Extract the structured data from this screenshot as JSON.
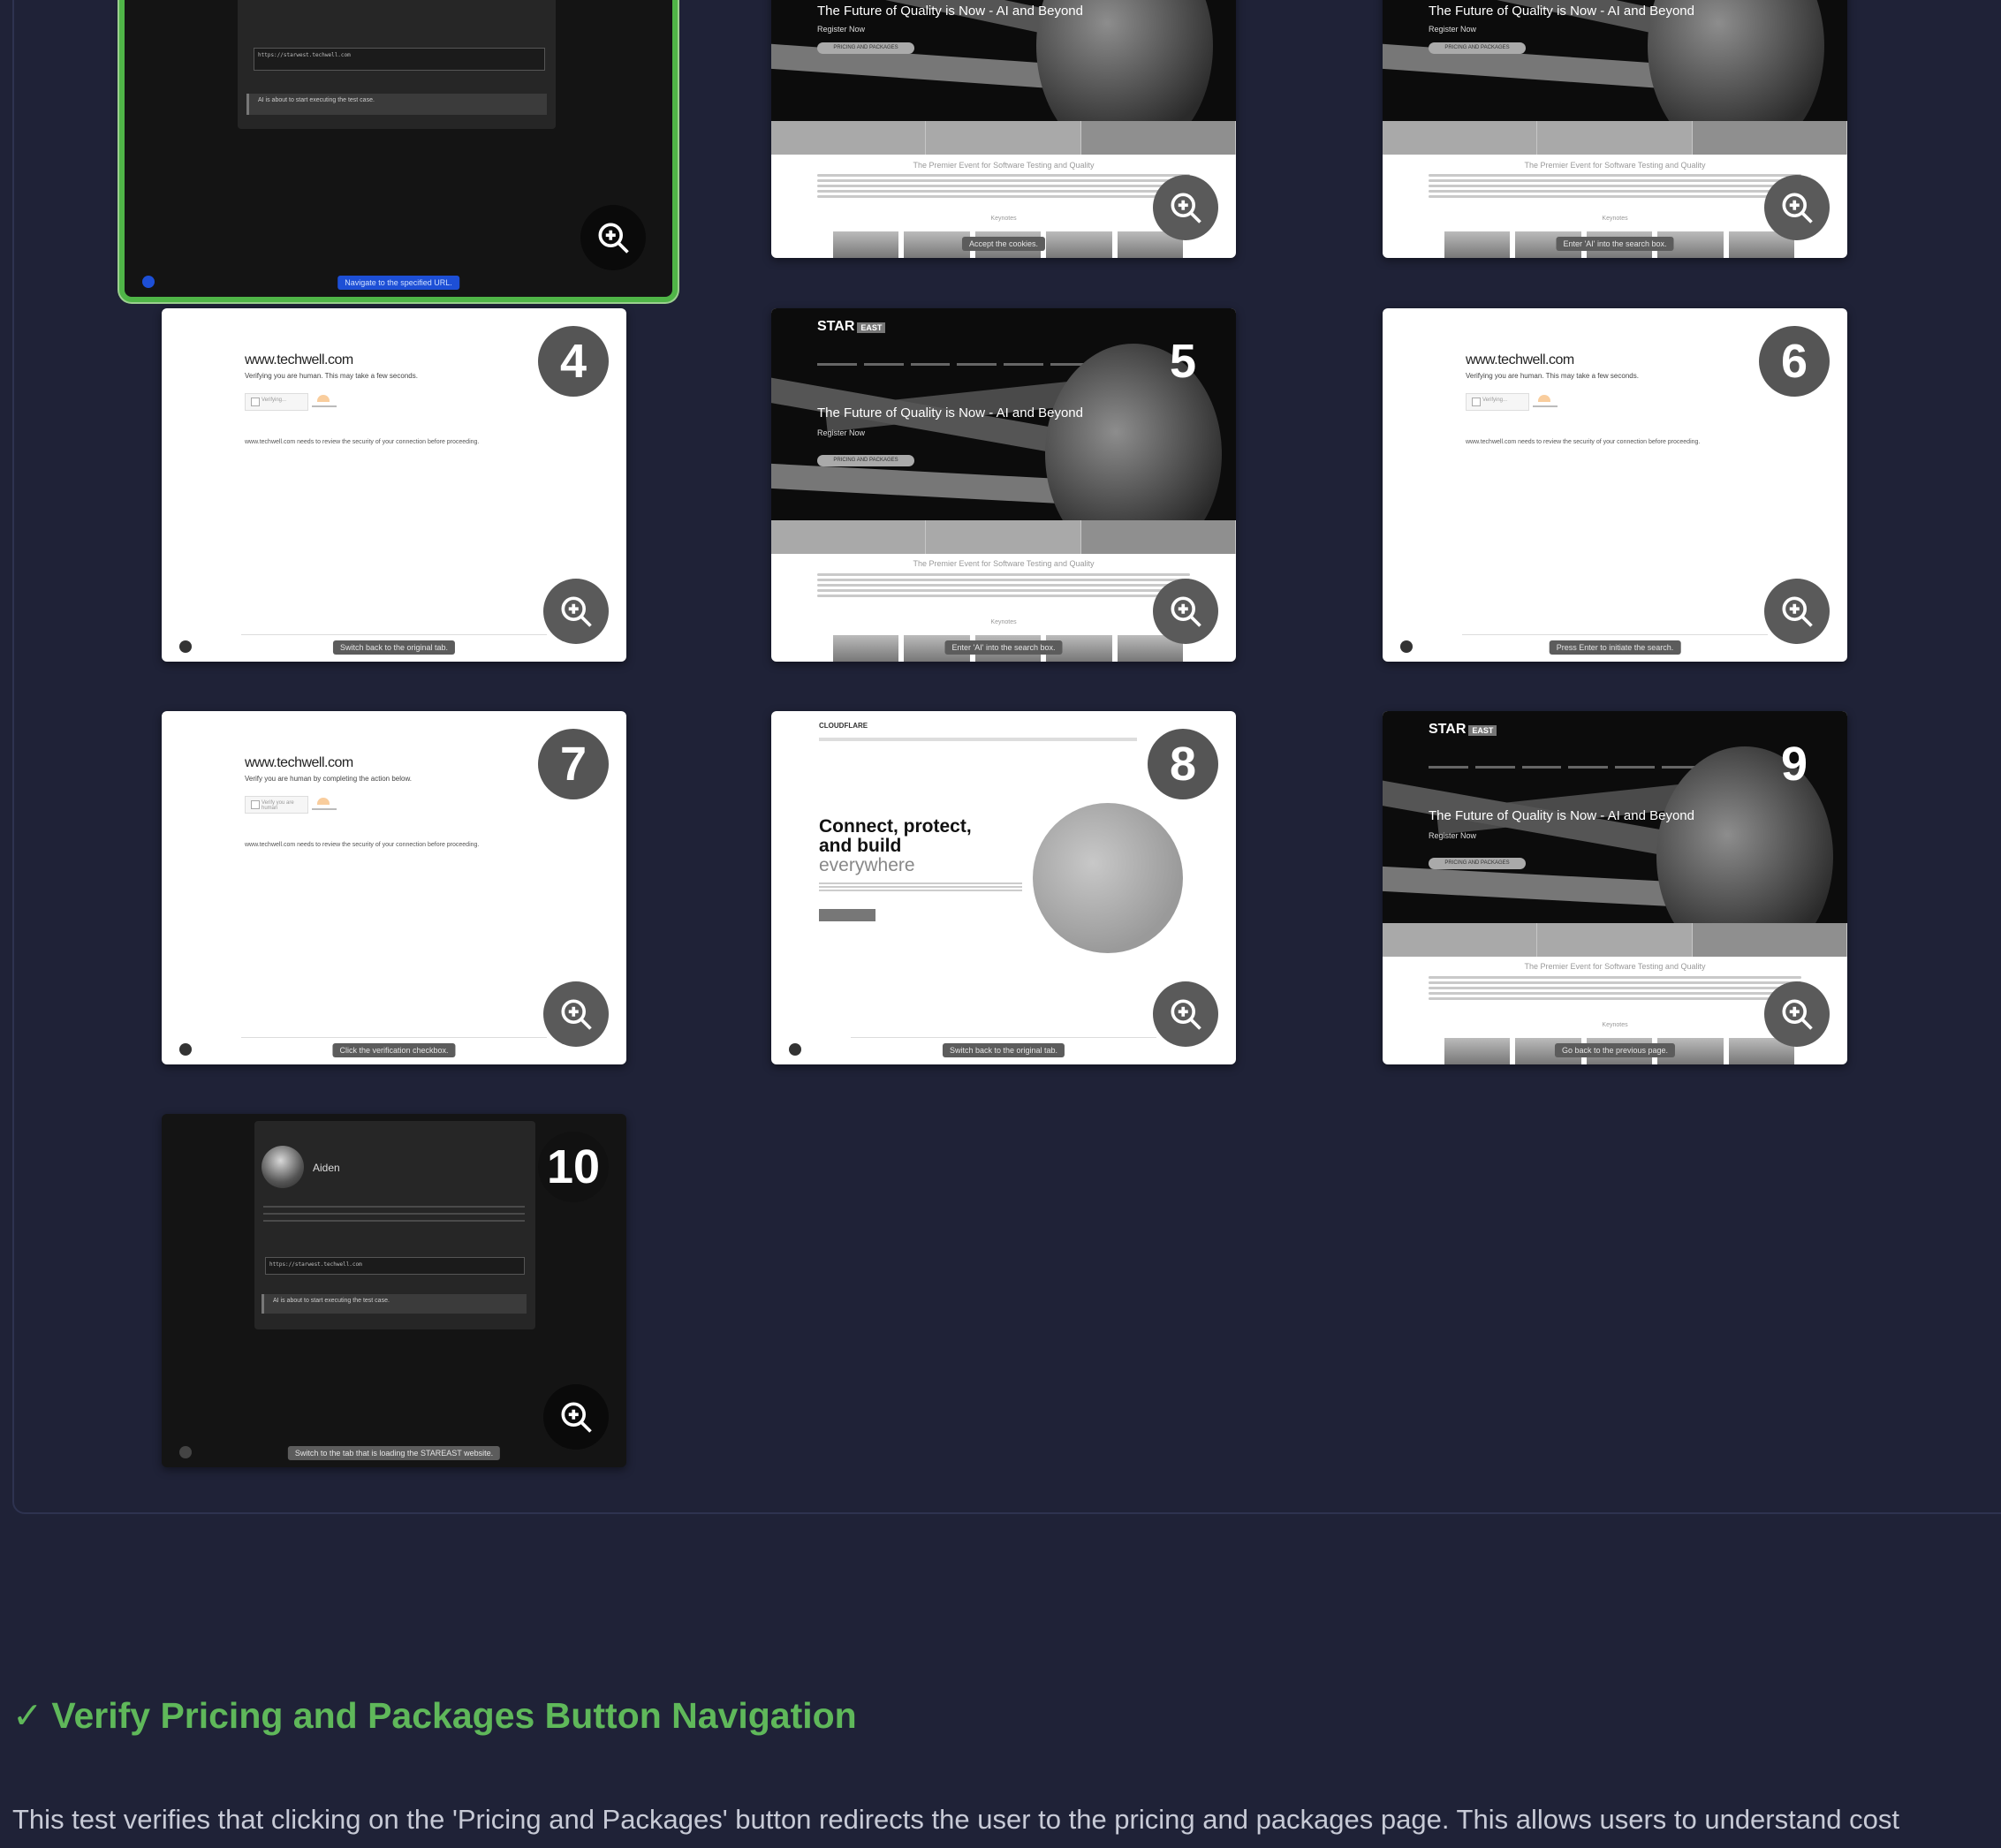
{
  "thumbnails": [
    {
      "number": "",
      "caption": "Navigate to the specified URL.",
      "url_field": "https://starwest.techwell.com",
      "status": "AI is about to start executing the test case."
    },
    {
      "number": "",
      "caption": "Accept the cookies."
    },
    {
      "number": "",
      "caption": "Enter 'AI' into the search box."
    },
    {
      "number": "4",
      "caption": "Switch back to the original tab.",
      "domain": "www.techwell.com",
      "subtitle": "Verifying you are human. This may take a few seconds.",
      "checkbox": "Verifying...",
      "body": "www.techwell.com needs to review the security of your connection before proceeding."
    },
    {
      "number": "5",
      "caption": "Enter 'AI' into the search box."
    },
    {
      "number": "6",
      "caption": "Press Enter to initiate the search.",
      "domain": "www.techwell.com",
      "subtitle": "Verifying you are human. This may take a few seconds.",
      "checkbox": "Verifying...",
      "body": "www.techwell.com needs to review the security of your connection before proceeding."
    },
    {
      "number": "7",
      "caption": "Click the verification checkbox.",
      "domain": "www.techwell.com",
      "subtitle": "Verify you are human by completing the action below.",
      "checkbox": "Verify you are human",
      "body": "www.techwell.com needs to review the security of your connection before proceeding."
    },
    {
      "number": "8",
      "caption": "Switch back to the original tab.",
      "brand": "CLOUDFLARE",
      "headline1": "Connect, protect,",
      "headline2": "and build",
      "headline3": "everywhere"
    },
    {
      "number": "9",
      "caption": "Go back to the previous page."
    },
    {
      "number": "10",
      "caption": "Switch to the tab that is loading the STAREAST website.",
      "name": "Aiden",
      "url_field": "https://starwest.techwell.com",
      "status": "AI is about to start executing the test case."
    }
  ],
  "star_page": {
    "logo": "STAR",
    "logo_tag": "EAST",
    "hero_title": "The Future of Quality is Now - AI and Beyond",
    "register": "Register Now",
    "pill": "PRICING AND PACKAGES",
    "section_title": "The Premier Event for Software Testing and Quality",
    "keynotes": "Keynotes"
  },
  "section": {
    "title": "Verify Pricing and Packages Button Navigation",
    "description": "This test verifies that clicking on the 'Pricing and Packages' button redirects the user to the pricing and packages page. This allows users to understand cost"
  },
  "colors": {
    "background": "#1f2237",
    "success": "#5fb85a",
    "selected_border": "#4fb547"
  },
  "icons": {
    "zoom": "zoom-in-icon",
    "check": "check-icon"
  }
}
